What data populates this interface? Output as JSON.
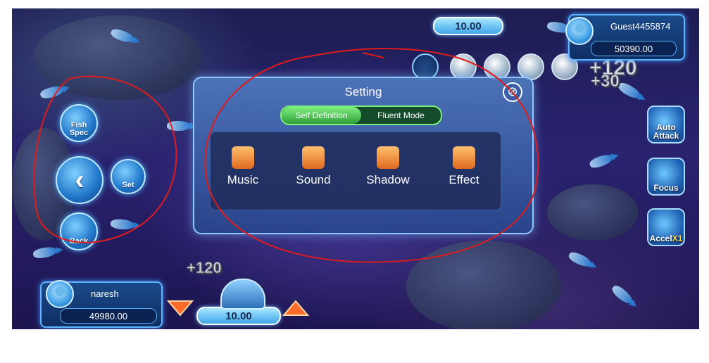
{
  "top_bet": "10.00",
  "player_top": {
    "name": "Guest4455874",
    "balance": "50390.00"
  },
  "player_bottom": {
    "name": "naresh",
    "balance": "49980.00"
  },
  "bottom_bet": "10.00",
  "bonus_top": [
    "+120",
    "+30"
  ],
  "bonus_bottom": "+120",
  "side_menu": {
    "fish_spec": "Fish Spec",
    "set": "Set",
    "back": "Back"
  },
  "right_buttons": {
    "auto": "Auto Attack",
    "focus": "Focus",
    "accel": "Accel",
    "accel_mult": "X1"
  },
  "dialog": {
    "title": "Setting",
    "close_symbol": "⊗",
    "modes": [
      "Self Definition",
      "Fluent Mode"
    ],
    "active_mode": "Self Definition",
    "options": [
      "Music",
      "Sound",
      "Shadow",
      "Effect"
    ]
  },
  "colors": {
    "annotation": "#e01b1b",
    "accent": "#5fb4ff",
    "toggle_active": "#2f9e3a"
  }
}
